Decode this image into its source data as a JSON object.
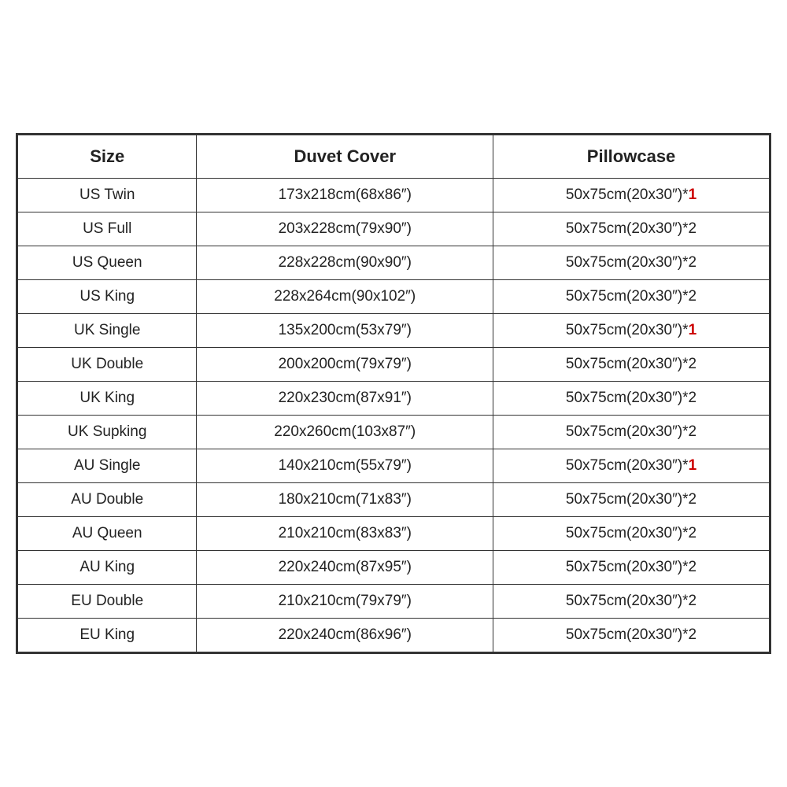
{
  "table": {
    "headers": [
      "Size",
      "Duvet Cover",
      "Pillowcase"
    ],
    "rows": [
      {
        "size": "US Twin",
        "duvet": "173x218cm(68x86″)",
        "pillowcase_plain": "50x75cm(20x30″)*",
        "pillowcase_suffix": "1",
        "suffix_red": true
      },
      {
        "size": "US Full",
        "duvet": "203x228cm(79x90″)",
        "pillowcase_plain": "50x75cm(20x30″)*2",
        "pillowcase_suffix": "",
        "suffix_red": false
      },
      {
        "size": "US Queen",
        "duvet": "228x228cm(90x90″)",
        "pillowcase_plain": "50x75cm(20x30″)*2",
        "pillowcase_suffix": "",
        "suffix_red": false
      },
      {
        "size": "US King",
        "duvet": "228x264cm(90x102″)",
        "pillowcase_plain": "50x75cm(20x30″)*2",
        "pillowcase_suffix": "",
        "suffix_red": false
      },
      {
        "size": "UK Single",
        "duvet": "135x200cm(53x79″)",
        "pillowcase_plain": "50x75cm(20x30″)*",
        "pillowcase_suffix": "1",
        "suffix_red": true
      },
      {
        "size": "UK Double",
        "duvet": "200x200cm(79x79″)",
        "pillowcase_plain": "50x75cm(20x30″)*2",
        "pillowcase_suffix": "",
        "suffix_red": false
      },
      {
        "size": "UK King",
        "duvet": "220x230cm(87x91″)",
        "pillowcase_plain": "50x75cm(20x30″)*2",
        "pillowcase_suffix": "",
        "suffix_red": false
      },
      {
        "size": "UK Supking",
        "duvet": "220x260cm(103x87″)",
        "pillowcase_plain": "50x75cm(20x30″)*2",
        "pillowcase_suffix": "",
        "suffix_red": false
      },
      {
        "size": "AU Single",
        "duvet": "140x210cm(55x79″)",
        "pillowcase_plain": "50x75cm(20x30″)*",
        "pillowcase_suffix": "1",
        "suffix_red": true
      },
      {
        "size": "AU Double",
        "duvet": "180x210cm(71x83″)",
        "pillowcase_plain": "50x75cm(20x30″)*2",
        "pillowcase_suffix": "",
        "suffix_red": false
      },
      {
        "size": "AU Queen",
        "duvet": "210x210cm(83x83″)",
        "pillowcase_plain": "50x75cm(20x30″)*2",
        "pillowcase_suffix": "",
        "suffix_red": false
      },
      {
        "size": "AU King",
        "duvet": "220x240cm(87x95″)",
        "pillowcase_plain": "50x75cm(20x30″)*2",
        "pillowcase_suffix": "",
        "suffix_red": false
      },
      {
        "size": "EU Double",
        "duvet": "210x210cm(79x79″)",
        "pillowcase_plain": "50x75cm(20x30″)*2",
        "pillowcase_suffix": "",
        "suffix_red": false
      },
      {
        "size": "EU King",
        "duvet": "220x240cm(86x96″)",
        "pillowcase_plain": "50x75cm(20x30″)*2",
        "pillowcase_suffix": "",
        "suffix_red": false
      }
    ]
  }
}
